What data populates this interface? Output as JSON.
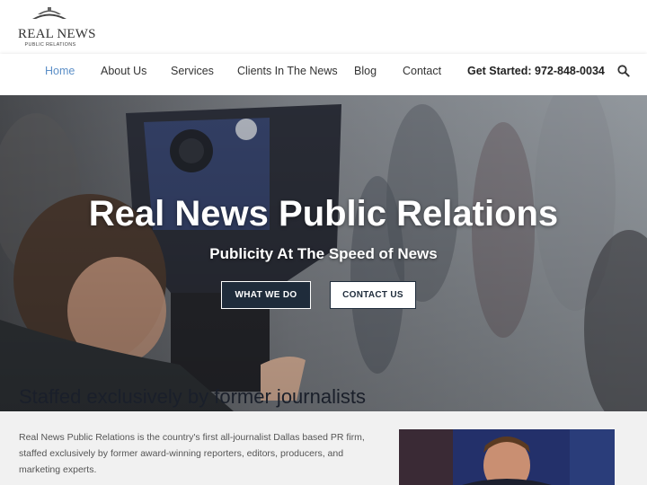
{
  "logo": {
    "title": "REAL NEWS",
    "subtitle": "PUBLIC RELATIONS",
    "icon": "ship-wave-icon"
  },
  "nav": {
    "items": [
      {
        "label": "Home",
        "active": true
      },
      {
        "label": "About Us",
        "active": false
      },
      {
        "label": "Services",
        "active": false
      },
      {
        "label": "Clients In The News",
        "active": false
      },
      {
        "label": "Blog",
        "active": false
      },
      {
        "label": "Contact",
        "active": false
      }
    ],
    "cta": "Get Started: 972-848-0034",
    "search_icon": "search-icon",
    "active_color": "#5c8fc7"
  },
  "hero": {
    "title": "Real News Public Relations",
    "subtitle": "Publicity At The Speed of News",
    "primary_button": "WHAT WE DO",
    "secondary_button": "CONTACT US",
    "tagline": "Staffed exclusively by former journalists",
    "button_dark_color": "#1f2c3b"
  },
  "content": {
    "paragraph": "Real News Public Relations is the country's first all-journalist Dallas based PR firm, staffed exclusively by former award-winning reporters, editors, producers, and marketing experts."
  }
}
